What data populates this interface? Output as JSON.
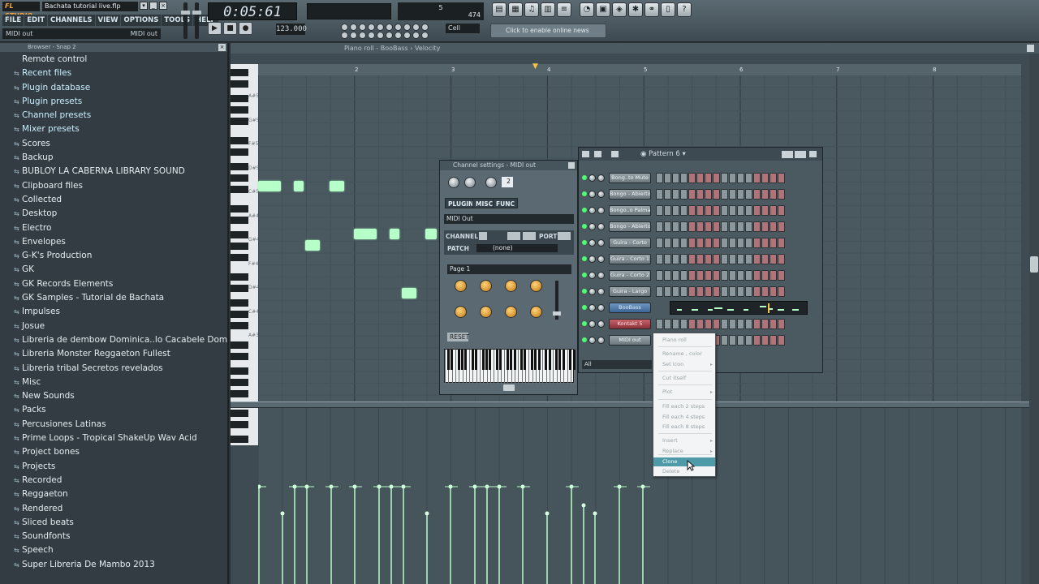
{
  "app": {
    "logo_text": "FL STUDIO",
    "file_title": "Bachata tutorial live.flp",
    "menu": [
      "FILE",
      "EDIT",
      "CHANNELS",
      "VIEW",
      "OPTIONS",
      "TOOLS",
      "HELP"
    ],
    "hint_left": "MIDI out",
    "hint_right": "MIDI out",
    "time": "0:05:61",
    "tempo": "123.000",
    "cpu_line1": "5",
    "cpu_line2": "474",
    "snap": "Cell",
    "news": "Click to enable online news"
  },
  "browser": {
    "header": "Browser - Snap 2",
    "items": [
      {
        "label": "Remote control",
        "glyph": ""
      },
      {
        "label": "Recent files",
        "glyph": "⇆"
      },
      {
        "label": "Plugin database",
        "glyph": "⇆"
      },
      {
        "label": "Plugin presets",
        "glyph": "⇆"
      },
      {
        "label": "Channel presets",
        "glyph": "⇆"
      },
      {
        "label": "Mixer presets",
        "glyph": "⇆"
      },
      {
        "label": "Scores",
        "glyph": "⇆"
      },
      {
        "label": "Backup",
        "glyph": "⇆"
      },
      {
        "label": "BUBLOY LA CABERNA LIBRARY SOUND",
        "glyph": "⇆"
      },
      {
        "label": "Clipboard files",
        "glyph": "⇆"
      },
      {
        "label": "Collected",
        "glyph": "⇆"
      },
      {
        "label": "Desktop",
        "glyph": "⇆"
      },
      {
        "label": "Electro",
        "glyph": "⇆"
      },
      {
        "label": "Envelopes",
        "glyph": "⇆"
      },
      {
        "label": "G-K's Production",
        "glyph": "⇆"
      },
      {
        "label": "GK",
        "glyph": "⇆"
      },
      {
        "label": "GK Records Elements",
        "glyph": "⇆"
      },
      {
        "label": "GK Samples - Tutorial de Bachata",
        "glyph": "⇆"
      },
      {
        "label": "Impulses",
        "glyph": "⇆"
      },
      {
        "label": "Josue",
        "glyph": "⇆"
      },
      {
        "label": "Libreria de dembow Dominica..lo Cacabele DominicanBeats",
        "glyph": "⇆"
      },
      {
        "label": "Libreria Monster Reggaeton Fullest",
        "glyph": "⇆"
      },
      {
        "label": "Libreria tribal Secretos revelados",
        "glyph": "⇆"
      },
      {
        "label": "Misc",
        "glyph": "⇆"
      },
      {
        "label": "New Sounds",
        "glyph": "⇆"
      },
      {
        "label": "Packs",
        "glyph": "⇆"
      },
      {
        "label": "Percusiones Latinas",
        "glyph": "⇆"
      },
      {
        "label": "Prime Loops - Tropical ShakeUp Wav Acid",
        "glyph": "⇆"
      },
      {
        "label": "Project bones",
        "glyph": "⇆"
      },
      {
        "label": "Projects",
        "glyph": "⇆"
      },
      {
        "label": "Recorded",
        "glyph": "⇆"
      },
      {
        "label": "Reggaeton",
        "glyph": "⇆"
      },
      {
        "label": "Rendered",
        "glyph": "⇆"
      },
      {
        "label": "Sliced beats",
        "glyph": "⇆"
      },
      {
        "label": "Soundfonts",
        "glyph": "⇆"
      },
      {
        "label": "Speech",
        "glyph": "⇆"
      },
      {
        "label": "Super Libreria De Mambo 2013",
        "glyph": "⇆"
      }
    ]
  },
  "pianoroll": {
    "title": "Piano roll - BooBass",
    "target": "Velocity",
    "bars": [
      "2",
      "3",
      "4",
      "5",
      "6",
      "7",
      "8"
    ],
    "key_labels": [
      "A#5",
      "G#5",
      "F#5",
      "D#5",
      "C#5",
      "A#4",
      "G#4",
      "F#4",
      "D#4",
      "C#4",
      "A#3"
    ]
  },
  "channel_settings": {
    "title": "Channel settings - MIDI out",
    "tabs": [
      "PLUGIN",
      "MISC",
      "FUNC"
    ],
    "plugin_name": "MIDI Out",
    "channel_label": "CHANNEL",
    "port_label": "PORT",
    "patch_label": "PATCH",
    "patch_value": "(none)",
    "page": "Page 1",
    "reset_label": "RESET",
    "channel_num": "2"
  },
  "step_sequencer": {
    "title": "Pattern 6",
    "channels": [
      {
        "name": "Bong..to Mute",
        "state": "normal"
      },
      {
        "name": "Bongo - Abierto",
        "state": "normal"
      },
      {
        "name": "Bongo..o Palma",
        "state": "normal"
      },
      {
        "name": "Bongo - Abierto",
        "state": "normal"
      },
      {
        "name": "Guira - Corto",
        "state": "normal"
      },
      {
        "name": "Guira - Corto 1",
        "state": "normal"
      },
      {
        "name": "Guira - Corto 2",
        "state": "normal"
      },
      {
        "name": "Guira - Largo",
        "state": "normal"
      },
      {
        "name": "BooBass",
        "state": "selected"
      },
      {
        "name": "Kontakt 5",
        "state": "red"
      },
      {
        "name": "MIDI out",
        "state": "normal"
      }
    ],
    "filter": "All"
  },
  "context_menu": {
    "items": [
      {
        "label": "Piano roll",
        "arrow": ""
      },
      {
        "label": "Rename , color",
        "arrow": ""
      },
      {
        "label": "Set icon",
        "arrow": "▸"
      },
      {
        "label": "Cut itself",
        "arrow": ""
      },
      {
        "label": "Plot",
        "arrow": "▸"
      },
      {
        "label": "Fill each 2 steps",
        "arrow": ""
      },
      {
        "label": "Fill each 4 steps",
        "arrow": ""
      },
      {
        "label": "Fill each 8 steps",
        "arrow": ""
      },
      {
        "label": "Insert",
        "arrow": "▸"
      },
      {
        "label": "Replace",
        "arrow": "▸"
      },
      {
        "label": "Clone",
        "arrow": ""
      },
      {
        "label": "Delete",
        "arrow": ""
      }
    ],
    "highlighted": "Clone"
  }
}
